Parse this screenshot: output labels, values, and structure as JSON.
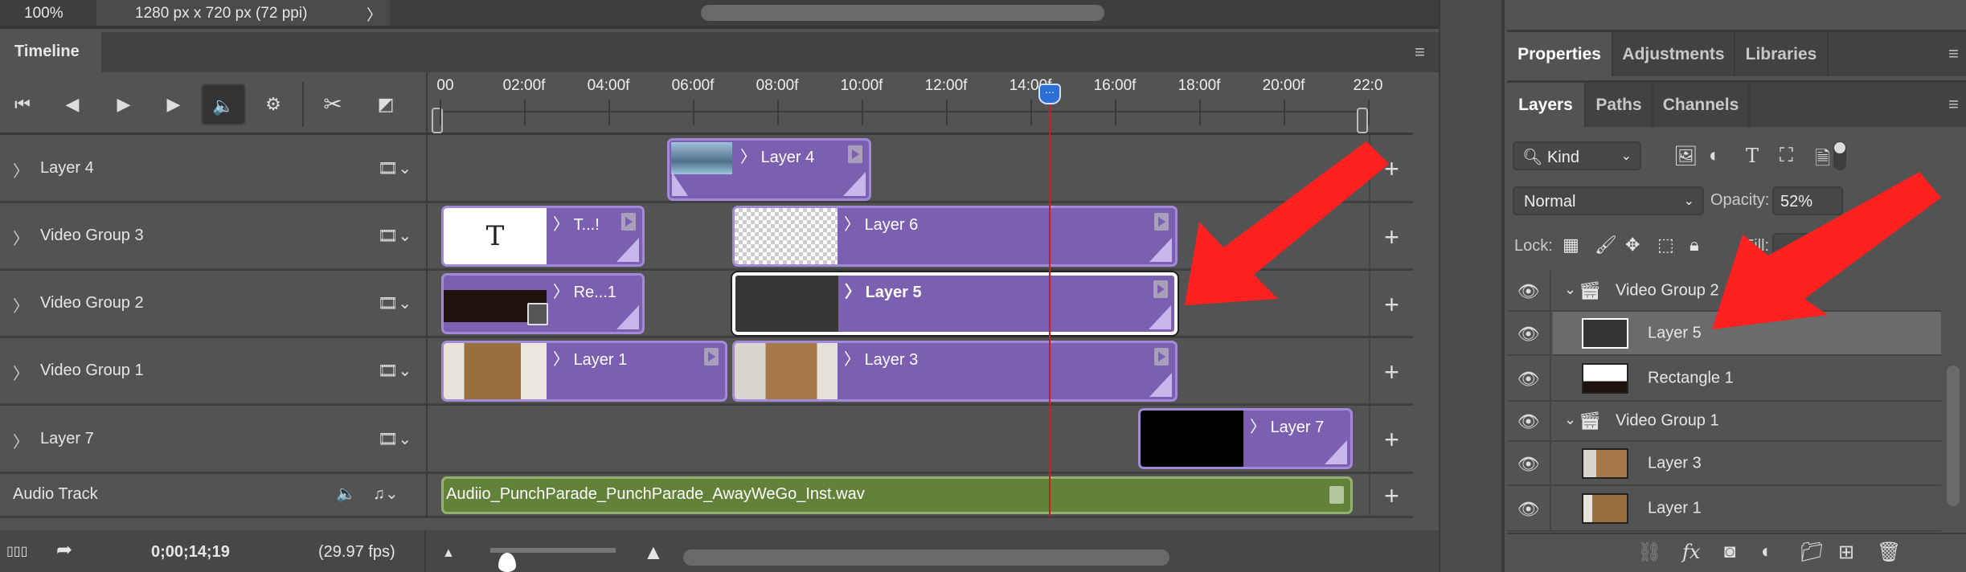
{
  "topbar": {
    "zoom": "100%",
    "doc_info": "1280 px x 720 px (72 ppi)",
    "chevron": "〉"
  },
  "timeline": {
    "tab": "Timeline",
    "ruler_labels": [
      "00",
      "02:00f",
      "04:00f",
      "06:00f",
      "08:00f",
      "10:00f",
      "12:00f",
      "14:00f",
      "16:00f",
      "18:00f",
      "20:00f",
      "22:0"
    ],
    "tracks": [
      {
        "name": "Layer 4",
        "icon": "film-icon"
      },
      {
        "name": "Video Group 3",
        "icon": "film-icon"
      },
      {
        "name": "Video Group 2",
        "icon": "film-icon"
      },
      {
        "name": "Video Group 1",
        "icon": "film-icon"
      },
      {
        "name": "Layer 7",
        "icon": "film-icon"
      }
    ],
    "audio_track": {
      "name": "Audio Track",
      "clip": "Audiio_PunchParade_PunchParade_AwayWeGo_Inst.wav"
    },
    "clips": {
      "layer4": "Layer 4",
      "text": "T...!",
      "layer6": "Layer 6",
      "rect": "Re...1",
      "layer5": "Layer 5",
      "layer1": "Layer 1",
      "layer3": "Layer 3",
      "layer7": "Layer 7"
    },
    "current_time": "0;00;14;19",
    "fps": "(29.97 fps)",
    "clip_color": "#7b5fb0",
    "audio_color": "#62823a",
    "playhead_color": "#c82020"
  },
  "panels": {
    "top_tabs": [
      "Properties",
      "Adjustments",
      "Libraries"
    ],
    "layer_tabs": [
      "Layers",
      "Paths",
      "Channels"
    ],
    "filter": "Kind",
    "blend_mode": "Normal",
    "opacity_label": "Opacity:",
    "opacity": "52%",
    "lock_label": "Lock:",
    "fill_label": "Fill:",
    "layers": [
      {
        "name": "Video Group 2",
        "type": "group",
        "selected": false
      },
      {
        "name": "Layer 5",
        "type": "layer",
        "selected": true
      },
      {
        "name": "Rectangle 1",
        "type": "shape",
        "selected": false
      },
      {
        "name": "Video Group 1",
        "type": "group",
        "selected": false
      },
      {
        "name": "Layer 3",
        "type": "smart",
        "selected": false
      },
      {
        "name": "Layer 1",
        "type": "smart",
        "selected": false
      }
    ]
  },
  "annotation_color": "#ff2020"
}
